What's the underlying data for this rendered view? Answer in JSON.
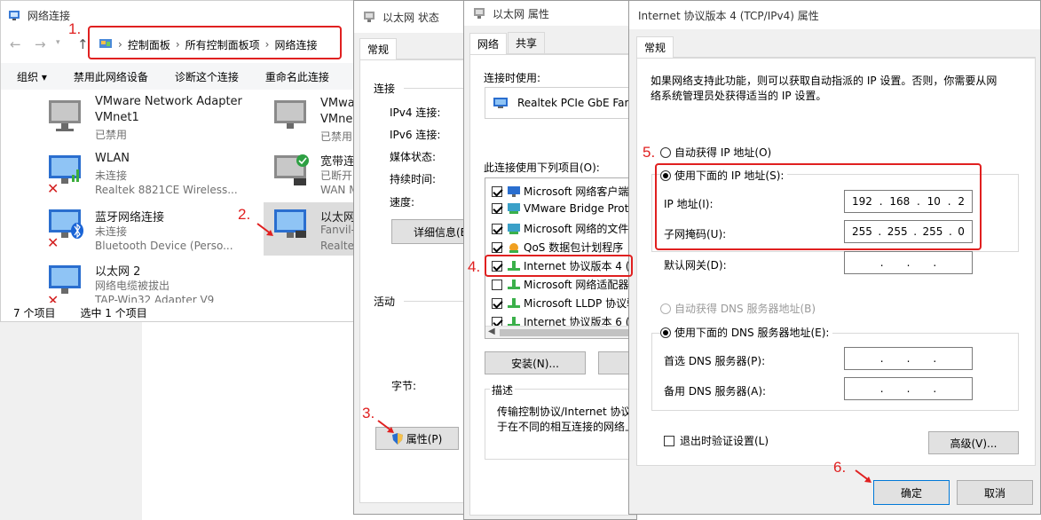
{
  "explorer": {
    "title": "网络连接",
    "breadcrumb": [
      "控制面板",
      "所有控制面板项",
      "网络连接"
    ],
    "toolbar": [
      "组织 ▾",
      "禁用此网络设备",
      "诊断这个连接",
      "重命名此连接"
    ],
    "items": [
      {
        "name": "VMware Network Adapter",
        "name2": "VMnet1",
        "status": "已禁用"
      },
      {
        "name": "WLAN",
        "status": "未连接",
        "device": "Realtek 8821CE Wireless..."
      },
      {
        "name": "蓝牙网络连接",
        "status": "未连接",
        "device": "Bluetooth Device (Perso..."
      },
      {
        "name": "以太网 2",
        "status": "网络电缆被拔出",
        "device": "TAP-Win32 Adapter V9"
      },
      {
        "name": "VMwa",
        "name2": "VMne",
        "status": "已禁用"
      },
      {
        "name": "宽带连",
        "status": "已断开",
        "device": "WAN M"
      },
      {
        "name": "以太网",
        "status": "Fanvil-",
        "device": "Realte"
      }
    ],
    "status_bar": {
      "count": "7 个项目",
      "selected": "选中 1 个项目"
    }
  },
  "status_dialog": {
    "title": "以太网 状态",
    "tab": "常规",
    "connection_label": "连接",
    "fields": [
      "IPv4 连接:",
      "IPv6 连接:",
      "媒体状态:",
      "持续时间:",
      "速度:"
    ],
    "details_button": "详细信息(E",
    "activity_label": "活动",
    "bytes_label": "字节:",
    "properties_button": "属性(P)"
  },
  "props_dialog": {
    "title": "以太网 属性",
    "tabs": [
      "网络",
      "共享"
    ],
    "connect_using_label": "连接时使用:",
    "adapter": "Realtek PCIe GbE Fam",
    "items_label": "此连接使用下列项目(O):",
    "items": [
      {
        "label": "Microsoft 网络客户端",
        "checked": true
      },
      {
        "label": "VMware Bridge Proto",
        "checked": true
      },
      {
        "label": "Microsoft 网络的文件",
        "checked": true
      },
      {
        "label": "QoS 数据包计划程序",
        "checked": true
      },
      {
        "label": "Internet 协议版本 4 (T",
        "checked": true
      },
      {
        "label": "Microsoft 网络适配器",
        "checked": false
      },
      {
        "label": "Microsoft LLDP 协议驱",
        "checked": true
      },
      {
        "label": "Internet 协议版本 6 (T",
        "checked": true
      }
    ],
    "install_button": "安装(N)...",
    "description_label": "描述",
    "description_text": [
      "传输控制协议/Internet 协议",
      "于在不同的相互连接的网络上"
    ]
  },
  "ipv4_dialog": {
    "title": "Internet 协议版本 4 (TCP/IPv4) 属性",
    "tab": "常规",
    "intro": [
      "如果网络支持此功能，则可以获取自动指派的 IP 设置。否则，你需要从网",
      "络系统管理员处获得适当的 IP 设置。"
    ],
    "auto_ip": "自动获得 IP 地址(O)",
    "manual_ip": "使用下面的 IP 地址(S):",
    "ip_label": "IP 地址(I):",
    "ip_value": [
      "192",
      "168",
      "10",
      "2"
    ],
    "mask_label": "子网掩码(U):",
    "mask_value": [
      "255",
      "255",
      "255",
      "0"
    ],
    "gateway_label": "默认网关(D):",
    "auto_dns": "自动获得 DNS 服务器地址(B)",
    "manual_dns": "使用下面的 DNS 服务器地址(E):",
    "pref_dns_label": "首选 DNS 服务器(P):",
    "alt_dns_label": "备用 DNS 服务器(A):",
    "validate_label": "退出时验证设置(L)",
    "advanced_button": "高级(V)...",
    "ok_button": "确定",
    "cancel_button": "取消"
  },
  "steps": [
    "1.",
    "2.",
    "3.",
    "4.",
    "5.",
    "6."
  ],
  "colors": {
    "annotation": "#e02020",
    "selection": "#cce8ff"
  }
}
